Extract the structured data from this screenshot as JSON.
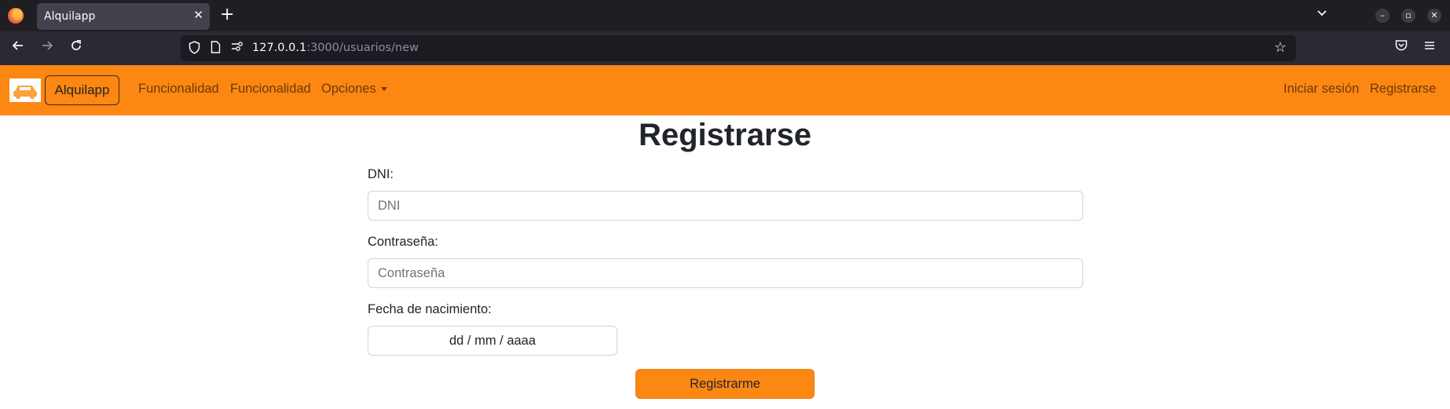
{
  "browser": {
    "tab_title": "Alquilapp",
    "tab_close": "✕",
    "new_tab": "+",
    "url_host": "127.0.0.1",
    "url_path": ":3000/usuarios/new"
  },
  "appbar": {
    "brand": "Alquilapp",
    "links": [
      "Funcionalidad",
      "Funcionalidad"
    ],
    "dropdown": "Opciones",
    "login": "Iniciar sesión",
    "register": "Registrarse",
    "accent_color": "#fd8713"
  },
  "form": {
    "title": "Registrarse",
    "dni_label": "DNI:",
    "dni_placeholder": "DNI",
    "password_label": "Contraseña:",
    "password_placeholder": "Contraseña",
    "birth_label": "Fecha de nacimiento:",
    "birth_value": "dd / mm / aaaa",
    "submit": "Registrarme"
  }
}
